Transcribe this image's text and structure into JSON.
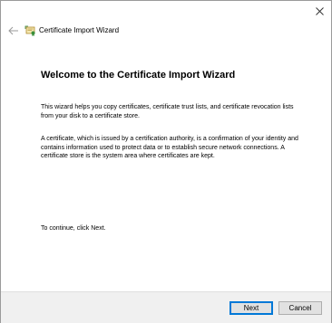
{
  "window": {
    "close_symbol": "close-icon"
  },
  "header": {
    "back_icon": "back-arrow-icon",
    "wizard_icon": "certificate-icon",
    "title": "Certificate Import Wizard"
  },
  "content": {
    "heading": "Welcome to the Certificate Import Wizard",
    "paragraph1": "This wizard helps you copy certificates, certificate trust lists, and certificate revocation lists from your disk to a certificate store.",
    "paragraph2": "A certificate, which is issued by a certification authority, is a confirmation of your identity and contains information used to protect data or to establish secure network connections. A certificate store is the system area where certificates are kept.",
    "continue_text": "To continue, click Next."
  },
  "footer": {
    "next_label": "Next",
    "cancel_label": "Cancel"
  },
  "colors": {
    "accent": "#0078d7",
    "footer_bg": "#f0f0f0",
    "button_bg": "#e1e1e1"
  }
}
